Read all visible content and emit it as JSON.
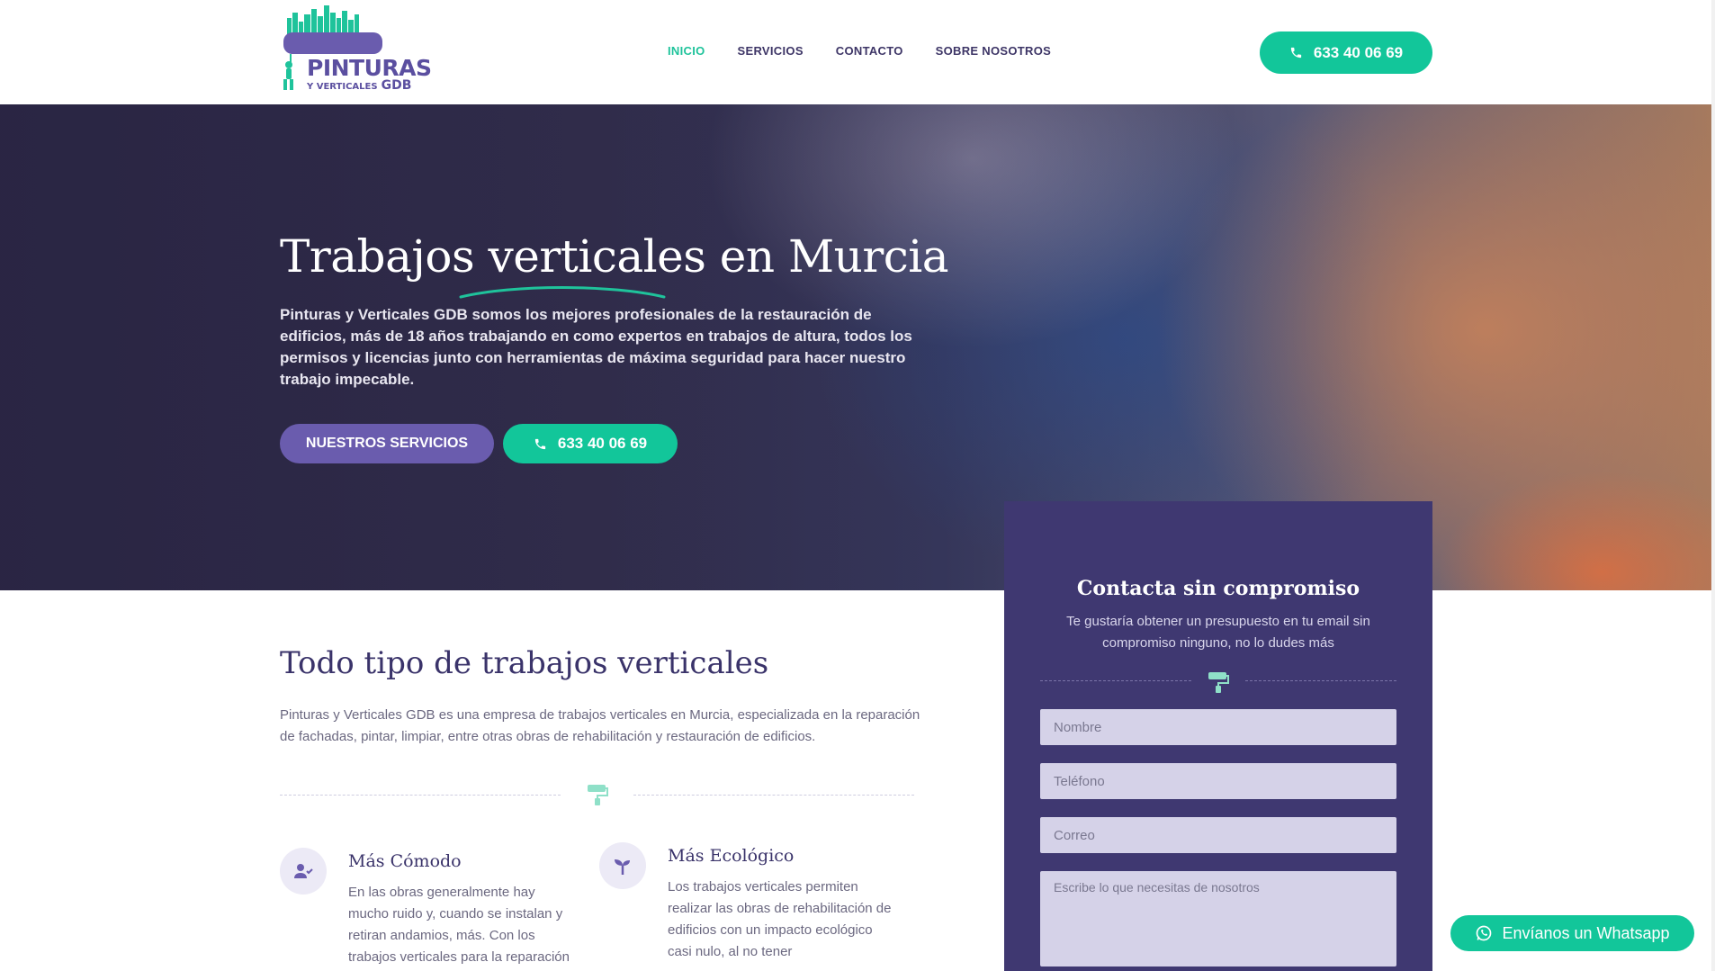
{
  "header": {
    "logo": {
      "title": "PINTURAS",
      "subtitle": "Y VERTICALES",
      "brand": "GDB"
    },
    "nav": [
      {
        "label": "INICIO",
        "active": true
      },
      {
        "label": "SERVICIOS",
        "active": false
      },
      {
        "label": "CONTACTO",
        "active": false
      },
      {
        "label": "SOBRE NOSOTROS",
        "active": false
      }
    ],
    "phone_button": {
      "label": "633 40 06 69",
      "icon": "phone-icon"
    }
  },
  "hero": {
    "title": "Trabajos verticales en Murcia",
    "text": "Pinturas y Verticales GDB somos los mejores profesionales de la restauración de edificios, más de 18 años trabajando en como expertos en trabajos de altura, todos los permisos y licencias junto con herramientas de máxima seguridad para hacer nuestro trabajo impecable.",
    "services_button": "NUESTROS SERVICIOS",
    "phone_button": "633 40 06 69"
  },
  "main": {
    "title": "Todo tipo de trabajos verticales",
    "text": "Pinturas y Verticales GDB es una empresa de trabajos verticales en Murcia, especializada en la reparación de fachadas, pintar, limpiar, entre otras obras de rehabilitación y restauración de edificios.",
    "features": [
      {
        "icon": "user-check-icon",
        "title": "Más Cómodo",
        "text": "En las obras generalmente hay mucho ruido y, cuando se instalan y retiran andamios, más. Con los trabajos verticales para la reparación de fachadas de edificios"
      },
      {
        "icon": "seedling-icon",
        "title": "Más Ecológico",
        "text": "Los trabajos verticales permiten realizar las obras de rehabilitación de edificios con un impacto ecológico casi nulo, al no tener"
      }
    ]
  },
  "contact": {
    "title": "Contacta sin compromiso",
    "subtitle": "Te gustaría obtener un presupuesto en tu email sin compromiso ninguno, no lo dudes más",
    "fields": {
      "name_placeholder": "Nombre",
      "phone_placeholder": "Teléfono",
      "email_placeholder": "Correo",
      "message_placeholder": "Escribe lo que necesitas de nosotros"
    }
  },
  "whatsapp": {
    "label": "Envíanos un Whatsapp",
    "icon": "whatsapp-icon"
  },
  "colors": {
    "primary_purple": "#3f3871",
    "accent_green": "#12c69a",
    "button_purple": "#6a5cae"
  }
}
